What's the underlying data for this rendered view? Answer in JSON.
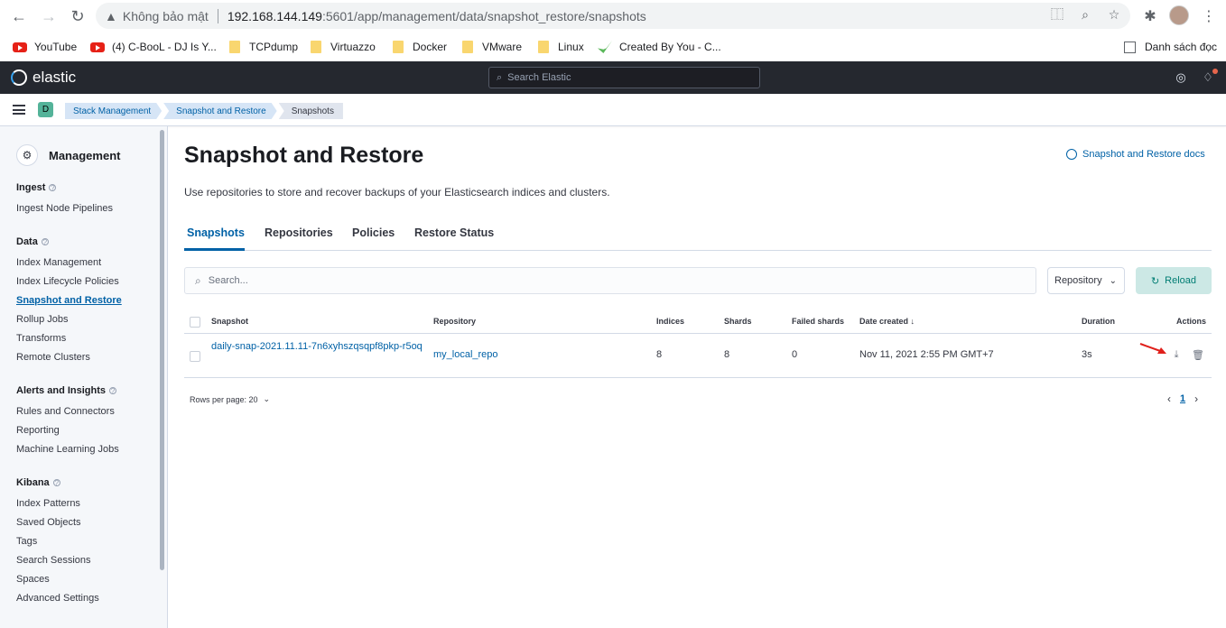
{
  "browser": {
    "security_label": "Không bảo mật",
    "url_host": "192.168.144.149",
    "url_path": ":5601/app/management/data/snapshot_restore/snapshots",
    "bookmarks": [
      "YouTube",
      "(4) C-BooL - DJ Is Y...",
      "TCPdump",
      "Virtuazzo",
      "Docker",
      "VMware",
      "Linux",
      "Created By You - C..."
    ],
    "reading_list": "Danh sách đọc"
  },
  "kibana": {
    "logo": "elastic",
    "search_placeholder": "Search Elastic",
    "space_badge": "D",
    "breadcrumbs": [
      "Stack Management",
      "Snapshot and Restore",
      "Snapshots"
    ]
  },
  "sidebar": {
    "title": "Management",
    "groups": [
      {
        "title": "Ingest",
        "items": [
          "Ingest Node Pipelines"
        ]
      },
      {
        "title": "Data",
        "items": [
          "Index Management",
          "Index Lifecycle Policies",
          "Snapshot and Restore",
          "Rollup Jobs",
          "Transforms",
          "Remote Clusters"
        ]
      },
      {
        "title": "Alerts and Insights",
        "items": [
          "Rules and Connectors",
          "Reporting",
          "Machine Learning Jobs"
        ]
      },
      {
        "title": "Kibana",
        "items": [
          "Index Patterns",
          "Saved Objects",
          "Tags",
          "Search Sessions",
          "Spaces",
          "Advanced Settings"
        ]
      }
    ],
    "active_item": "Snapshot and Restore"
  },
  "main": {
    "title": "Snapshot and Restore",
    "docs_link": "Snapshot and Restore docs",
    "description": "Use repositories to store and recover backups of your Elasticsearch indices and clusters.",
    "tabs": [
      "Snapshots",
      "Repositories",
      "Policies",
      "Restore Status"
    ],
    "selected_tab": "Snapshots",
    "search_placeholder": "Search...",
    "repository_filter": "Repository",
    "reload_label": "Reload",
    "table": {
      "columns": [
        "Snapshot",
        "Repository",
        "Indices",
        "Shards",
        "Failed shards",
        "Date created",
        "Duration",
        "Actions"
      ],
      "sort_indicator": "↓",
      "rows": [
        {
          "snapshot": "daily-snap-2021.11.11-7n6xyhszqsqpf8pkp-r5oq",
          "repository": "my_local_repo",
          "indices": "8",
          "shards": "8",
          "failed_shards": "0",
          "date_created": "Nov 11, 2021 2:55 PM GMT+7",
          "duration": "3s"
        }
      ]
    },
    "rows_per_page": "Rows per page: 20",
    "current_page": "1"
  },
  "colors": {
    "primary": "#0061a6",
    "header_bg": "#25282f",
    "reload_bg": "#cce8e5",
    "reload_text": "#017d73",
    "annotation_arrow": "#e0201b"
  }
}
